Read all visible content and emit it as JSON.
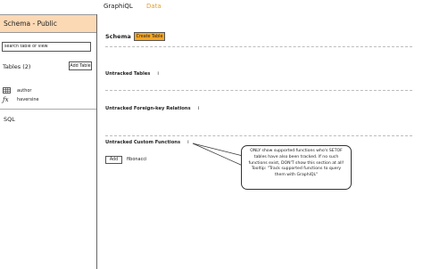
{
  "nav": {
    "tabs": [
      {
        "label": "GraphiQL"
      },
      {
        "label": "Data",
        "active": true
      }
    ],
    "active_color": "#e0a030"
  },
  "sidebar": {
    "schema_header": "Schema - Public",
    "schema_header_bg": "#fbd9b5",
    "search_placeholder": "search table or view",
    "tables_label": "Tables (2)",
    "add_table_label": "Add Table",
    "items": [
      {
        "icon": "table-icon",
        "label": "author"
      },
      {
        "icon": "function-icon",
        "label": "haversine"
      }
    ],
    "sql_label": "SQL"
  },
  "main": {
    "title": "Schema",
    "create_table_label": "Create Table",
    "create_table_color": "#f5a623",
    "sections": [
      {
        "title": "Untracked Tables",
        "info": "i"
      },
      {
        "title": "Untracked Foreign-key Relations",
        "info": "i"
      },
      {
        "title": "Untracked Custom Functions",
        "info": "i"
      }
    ],
    "add_label": "Add",
    "untracked_function": "fibonacci"
  },
  "annotation": {
    "text": "ONLY show supported functions who's SETOF tables have also been tracked. If no such functions exist, DON'T show this section at all! Tooltip: \"Track supported functions to query them with GraphiQL\""
  }
}
